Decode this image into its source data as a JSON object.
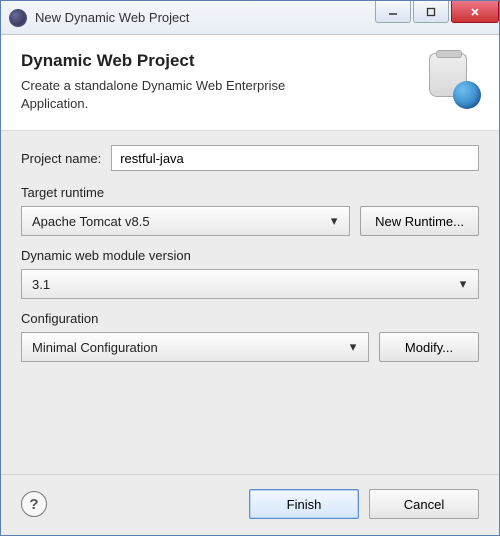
{
  "window": {
    "title": "New Dynamic Web Project"
  },
  "banner": {
    "title": "Dynamic Web Project",
    "description": "Create a standalone Dynamic Web Enterprise Application."
  },
  "projectName": {
    "label": "Project name:",
    "value": "restful-java"
  },
  "targetRuntime": {
    "label": "Target runtime",
    "selected": "Apache Tomcat v8.5",
    "newButton": "New Runtime..."
  },
  "moduleVersion": {
    "label": "Dynamic web module version",
    "selected": "3.1"
  },
  "configuration": {
    "label": "Configuration",
    "selected": "Minimal Configuration",
    "modifyButton": "Modify..."
  },
  "footer": {
    "finish": "Finish",
    "cancel": "Cancel"
  }
}
